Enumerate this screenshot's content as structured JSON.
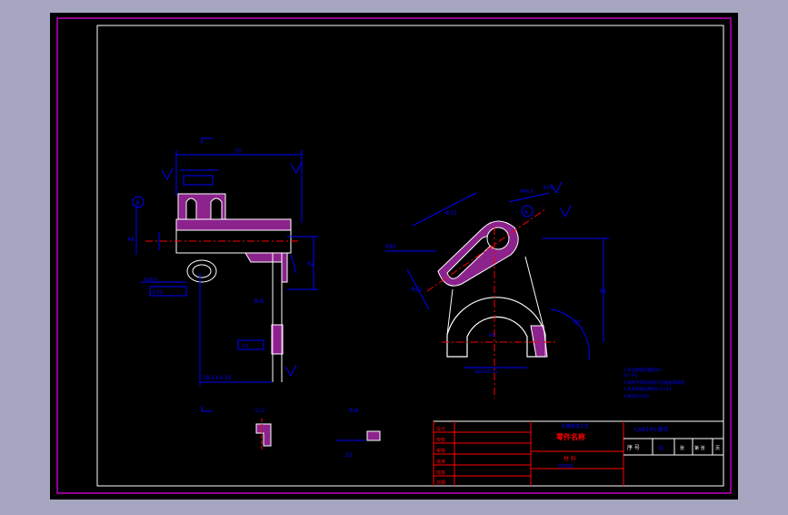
{
  "colors": {
    "background": "#a6a6c0",
    "canvas": "#000000",
    "frame": "#ffffff",
    "border_magenta": "#c000c0",
    "geometry": "#ffffff",
    "dimension": "#0000ff",
    "hatch": "#ff40ff",
    "centerline": "#ff0000",
    "title_red": "#ff0000"
  },
  "labels": {
    "section_a": "A",
    "section_b_left": "B-B",
    "section_c": "C-C",
    "section_b": "B-B",
    "dim_top": "70",
    "dim_side": "48",
    "dim_vert": "62",
    "dim_bottom": "58.5±0.15",
    "dim_angle": "30°",
    "dim_r": "R20",
    "dim_phi": "Φ21",
    "dim_slot": "Φ20±0.11",
    "dim_note": "Φ16.5",
    "dim_tol_a": "0.02",
    "dim_tol_b": "0.1",
    "dim_right_1": "Φ72",
    "dim_right_2": "R25",
    "dim_right_3": "Φ45.5",
    "dim_right_4": "61",
    "dim_small": "45°",
    "dim_small_2": "25"
  },
  "notes": {
    "line1": "1.未注明铸造圆角R3",
    "line2": "  R2~R5",
    "line3": "2.铸件不得有砂眼气孔缩松等缺陷",
    "line4": "3.去毛刺锐边倒钝0.5×45°",
    "line5": "4.材料HT200"
  },
  "title_block": {
    "header": "机械制造工艺",
    "part_name": "零件名称",
    "material_label": "材  料",
    "material_value": "HT200",
    "code": "CA6140-拨叉",
    "seq_label": "序  号",
    "qty": "01",
    "cell_1": "张",
    "cell_2": "第  张",
    "cell_3": "页",
    "row_labels": [
      "设计",
      "校核",
      "审核",
      "批准",
      "班级",
      "日期"
    ]
  }
}
